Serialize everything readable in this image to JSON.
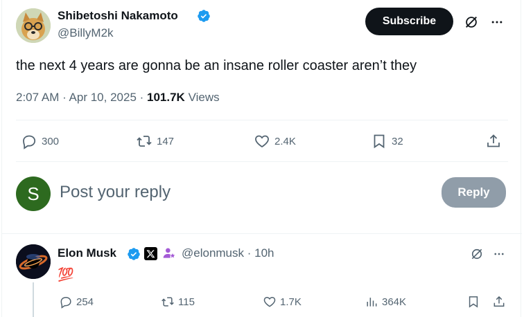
{
  "tweet": {
    "author_name": "Shibetoshi Nakamoto",
    "author_handle": "@BillyM2k",
    "subscribe_label": "Subscribe",
    "text": "the next 4 years are gonna be an insane roller coaster aren’t they",
    "time": "2:07 AM",
    "date": "Apr 10, 2025",
    "views_count": "101.7K",
    "views_label": "Views",
    "actions": {
      "replies": "300",
      "reposts": "147",
      "likes": "2.4K",
      "bookmarks": "32"
    }
  },
  "composer": {
    "avatar_letter": "S",
    "placeholder": "Post your reply",
    "reply_label": "Reply"
  },
  "reply": {
    "author_name": "Elon Musk",
    "author_handle": "@elonmusk",
    "time": "10h",
    "text": "💯",
    "actions": {
      "replies": "254",
      "reposts": "115",
      "likes": "1.7K",
      "views": "364K"
    }
  },
  "colors": {
    "verified": "#1d9bf0",
    "subscribe_bg": "#0f1419",
    "reply_btn_bg": "#8b98a5",
    "composer_avatar": "#2d6a1f",
    "secondary_text": "#536471"
  }
}
